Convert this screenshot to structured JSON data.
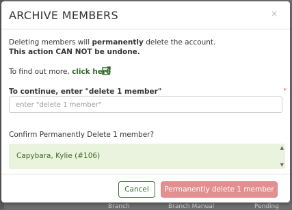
{
  "modal": {
    "title": "ARCHIVE MEMBERS",
    "close_label": "×",
    "warning_prefix": "Deleting members will ",
    "warning_bold": "permanently",
    "warning_suffix": " delete the account.",
    "undo_notice": "This action CAN NOT be undone.",
    "find_out_prefix": "To find out more, ",
    "find_out_link": "click here",
    "input_label": "To continue, enter \"delete 1 member\"",
    "input_required_mark": "*",
    "input_placeholder": "enter \"delete 1 member\"",
    "input_value": "",
    "confirm_prompt": "Confirm Permanently Delete 1 member?",
    "members": [
      "Capybara, Kylie (#106)"
    ],
    "cancel_label": "Cancel",
    "delete_label": "Permanently delete 1 member"
  },
  "colors": {
    "accent": "#3c6d34",
    "danger": "#e38f8f",
    "list_background": "#eaf3dd"
  },
  "background": {
    "fragments": [
      "Branch",
      "Branch Manual",
      "Pending"
    ]
  }
}
